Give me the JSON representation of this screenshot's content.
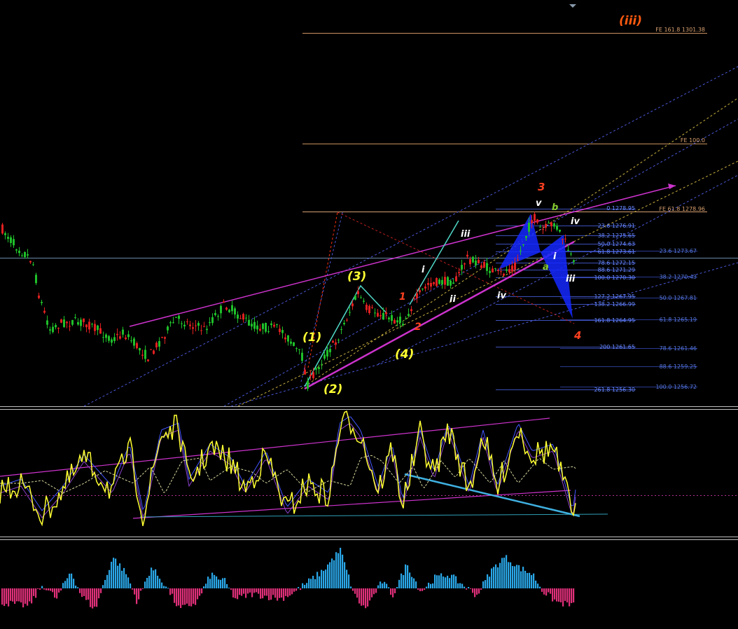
{
  "chart_data": {
    "type": "candlestick",
    "wave_labels": {
      "primary": [
        "(1)",
        "(2)",
        "(3)",
        "(4)",
        "(iii)"
      ],
      "intermediate": [
        "1",
        "2",
        "3",
        "4"
      ],
      "minor": [
        "i",
        "ii",
        "iii",
        "iv",
        "v"
      ],
      "correction": [
        "a",
        "b",
        "i",
        "iii",
        "iv"
      ]
    },
    "fib_levels_center": [
      "0 1278.95",
      "23.6 1276.91",
      "38.2 1275.65",
      "50.0 1274.63",
      "61.8 1273.61",
      "78.6 1272.15",
      "88.6 1271.29",
      "100.0 1270.30",
      "127.2 1267.95",
      "138.2 1266.99",
      "161.8 1264.95",
      "200 1261.65",
      "261.8 1256.30"
    ],
    "fib_levels_right": [
      "23.6 1273.67",
      "38.2 1270.43",
      "50.0 1267.81",
      "61.8 1265.19",
      "78.6 1261.46",
      "88.6 1259.25",
      "100.0 1256.72"
    ],
    "fe_levels": [
      "FE 161.8 1301.38",
      "FE 100.0",
      "FE 61.8 1278.96"
    ],
    "colors": {
      "bull": "#1fbf2a",
      "bear": "#e02020",
      "trend": "#cc33cc",
      "osc": "#ffff33",
      "osc_band": "#4455ff",
      "hist_pos": "#2aa7e8",
      "hist_neg": "#e0307a",
      "divergence": "#3fb0e0",
      "fib": "#6688ff",
      "fe": "#d8a070"
    }
  }
}
